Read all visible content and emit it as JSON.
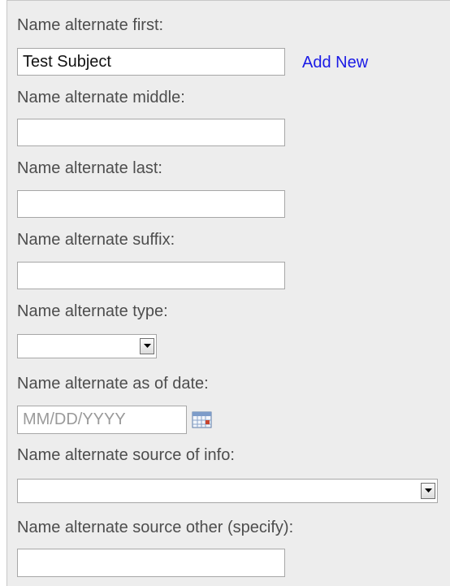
{
  "form": {
    "first": {
      "label": "Name alternate first:",
      "value": "Test Subject"
    },
    "add_new": "Add New",
    "middle": {
      "label": "Name alternate middle:",
      "value": ""
    },
    "last": {
      "label": "Name alternate last:",
      "value": ""
    },
    "suffix": {
      "label": "Name alternate suffix:",
      "value": ""
    },
    "type": {
      "label": "Name alternate type:",
      "selected": ""
    },
    "as_of_date": {
      "label": "Name alternate as of date:",
      "placeholder": "MM/DD/YYYY",
      "icon": "calendar-icon"
    },
    "source": {
      "label": "Name alternate source of info:",
      "selected": ""
    },
    "source_other": {
      "label": "Name alternate source other (specify):",
      "value": ""
    }
  },
  "colors": {
    "panel_bg": "#ededed",
    "label_text": "#4d4d4d",
    "link": "#1a1ae6",
    "input_border": "#a7a7a7"
  }
}
